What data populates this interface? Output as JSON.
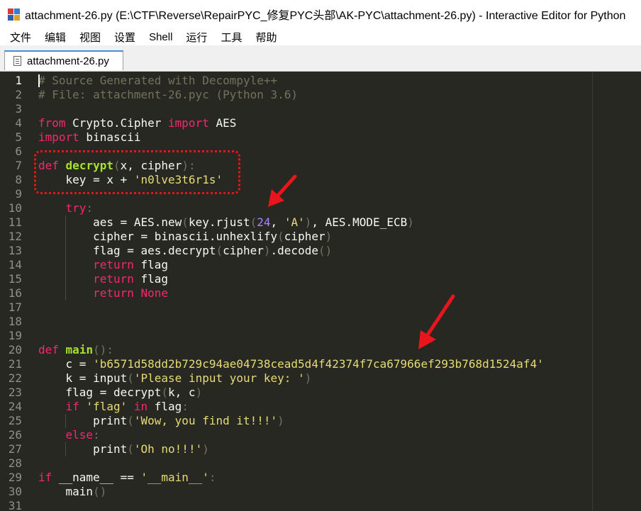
{
  "window": {
    "title": "attachment-26.py (E:\\CTF\\Reverse\\RepairPYC_修复PYC头部\\AK-PYC\\attachment-26.py) - Interactive Editor for Python"
  },
  "menu": [
    "文件",
    "编辑",
    "视图",
    "设置",
    "Shell",
    "运行",
    "工具",
    "帮助"
  ],
  "tab": {
    "label": "attachment-26.py"
  },
  "editor": {
    "current_line": 1,
    "lines": [
      [
        {
          "t": "# Source Generated with Decompyle++",
          "c": "cmt"
        }
      ],
      [
        {
          "t": "# File: attachment-26.pyc (Python 3.6)",
          "c": "cmt"
        }
      ],
      [],
      [
        {
          "t": "from",
          "c": "kw"
        },
        {
          "t": " Crypto.Cipher ",
          "c": "id"
        },
        {
          "t": "import",
          "c": "kw"
        },
        {
          "t": " AES",
          "c": "id"
        }
      ],
      [
        {
          "t": "import",
          "c": "kw"
        },
        {
          "t": " binascii",
          "c": "id"
        }
      ],
      [],
      [
        {
          "t": "def",
          "c": "kw"
        },
        {
          "t": " ",
          "c": "id"
        },
        {
          "t": "decrypt",
          "c": "fn"
        },
        {
          "t": "(",
          "c": "par"
        },
        {
          "t": "x, cipher",
          "c": "id"
        },
        {
          "t": "):",
          "c": "par"
        }
      ],
      [
        {
          "t": "    key = x + ",
          "c": "id"
        },
        {
          "t": "'n0lve3t6r1s'",
          "c": "str"
        }
      ],
      [],
      [
        {
          "t": "    ",
          "c": "id"
        },
        {
          "t": "try",
          "c": "kw"
        },
        {
          "t": ":",
          "c": "par"
        }
      ],
      [
        {
          "t": "        aes = AES.new",
          "c": "id"
        },
        {
          "t": "(",
          "c": "par"
        },
        {
          "t": "key.rjust",
          "c": "id"
        },
        {
          "t": "(",
          "c": "par"
        },
        {
          "t": "24",
          "c": "num"
        },
        {
          "t": ", ",
          "c": "id"
        },
        {
          "t": "'A'",
          "c": "str"
        },
        {
          "t": ")",
          "c": "par"
        },
        {
          "t": ", AES.MODE_ECB",
          "c": "id"
        },
        {
          "t": ")",
          "c": "par"
        }
      ],
      [
        {
          "t": "        cipher = binascii.unhexlify",
          "c": "id"
        },
        {
          "t": "(",
          "c": "par"
        },
        {
          "t": "cipher",
          "c": "id"
        },
        {
          "t": ")",
          "c": "par"
        }
      ],
      [
        {
          "t": "        flag = aes.decrypt",
          "c": "id"
        },
        {
          "t": "(",
          "c": "par"
        },
        {
          "t": "cipher",
          "c": "id"
        },
        {
          "t": ")",
          "c": "par"
        },
        {
          "t": ".decode",
          "c": "id"
        },
        {
          "t": "()",
          "c": "par"
        }
      ],
      [
        {
          "t": "        ",
          "c": "id"
        },
        {
          "t": "return",
          "c": "kw"
        },
        {
          "t": " flag",
          "c": "id"
        }
      ],
      [
        {
          "t": "        ",
          "c": "id"
        },
        {
          "t": "return",
          "c": "kw"
        },
        {
          "t": " flag",
          "c": "id"
        }
      ],
      [
        {
          "t": "        ",
          "c": "id"
        },
        {
          "t": "return",
          "c": "kw"
        },
        {
          "t": " None",
          "c": "kw"
        }
      ],
      [],
      [],
      [],
      [
        {
          "t": "def",
          "c": "kw"
        },
        {
          "t": " ",
          "c": "id"
        },
        {
          "t": "main",
          "c": "fn"
        },
        {
          "t": "():",
          "c": "par"
        }
      ],
      [
        {
          "t": "    c = ",
          "c": "id"
        },
        {
          "t": "'b6571d58dd2b729c94ae04738cead5d4f42374f7ca67966ef293b768d1524af4'",
          "c": "str"
        }
      ],
      [
        {
          "t": "    k = input",
          "c": "id"
        },
        {
          "t": "(",
          "c": "par"
        },
        {
          "t": "'Please input your key: '",
          "c": "str"
        },
        {
          "t": ")",
          "c": "par"
        }
      ],
      [
        {
          "t": "    flag = decrypt",
          "c": "id"
        },
        {
          "t": "(",
          "c": "par"
        },
        {
          "t": "k, c",
          "c": "id"
        },
        {
          "t": ")",
          "c": "par"
        }
      ],
      [
        {
          "t": "    ",
          "c": "id"
        },
        {
          "t": "if",
          "c": "kw"
        },
        {
          "t": " ",
          "c": "id"
        },
        {
          "t": "'flag'",
          "c": "str"
        },
        {
          "t": " ",
          "c": "id"
        },
        {
          "t": "in",
          "c": "kw"
        },
        {
          "t": " flag",
          "c": "id"
        },
        {
          "t": ":",
          "c": "par"
        }
      ],
      [
        {
          "t": "        print",
          "c": "id"
        },
        {
          "t": "(",
          "c": "par"
        },
        {
          "t": "'Wow, you find it!!!'",
          "c": "str"
        },
        {
          "t": ")",
          "c": "par"
        }
      ],
      [
        {
          "t": "    ",
          "c": "id"
        },
        {
          "t": "else",
          "c": "kw"
        },
        {
          "t": ":",
          "c": "par"
        }
      ],
      [
        {
          "t": "        print",
          "c": "id"
        },
        {
          "t": "(",
          "c": "par"
        },
        {
          "t": "'Oh no!!!'",
          "c": "str"
        },
        {
          "t": ")",
          "c": "par"
        }
      ],
      [],
      [
        {
          "t": "if",
          "c": "kw"
        },
        {
          "t": " __name__ == ",
          "c": "id"
        },
        {
          "t": "'__main__'",
          "c": "str"
        },
        {
          "t": ":",
          "c": "par"
        }
      ],
      [
        {
          "t": "    main",
          "c": "id"
        },
        {
          "t": "()",
          "c": "par"
        }
      ],
      []
    ]
  },
  "annotations": {
    "color": "#e8161c"
  },
  "colors": {
    "editor_bg": "#272822",
    "keyword": "#f92672",
    "function": "#a6e22e",
    "string": "#e6db74",
    "number": "#ae81ff",
    "comment": "#75715e",
    "text": "#f8f8f2"
  }
}
